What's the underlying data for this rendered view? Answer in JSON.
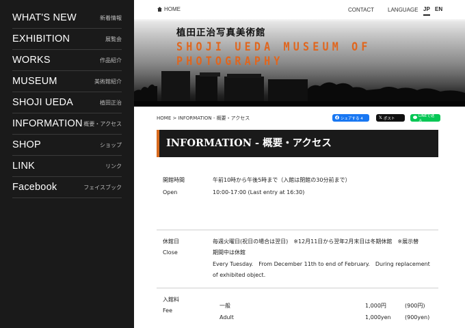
{
  "sidebar": {
    "items": [
      {
        "en": "WHAT'S NEW",
        "ja": "新着情報"
      },
      {
        "en": "EXHIBITION",
        "ja": "展覧会"
      },
      {
        "en": "WORKS",
        "ja": "作品紹介"
      },
      {
        "en": "MUSEUM",
        "ja": "美術館紹介"
      },
      {
        "en": "SHOJI UEDA",
        "ja": "植田正治"
      },
      {
        "en": "INFORMATION",
        "ja": "概要・アクセス"
      },
      {
        "en": "SHOP",
        "ja": "ショップ"
      },
      {
        "en": "LINK",
        "ja": "リンク"
      },
      {
        "en": "Facebook",
        "ja": "フェイスブック"
      }
    ]
  },
  "header": {
    "home_label": "HOME",
    "contact_label": "CONTACT",
    "language_label": "LANGUAGE",
    "lang_jp": "JP",
    "lang_en": "EN",
    "museum_name_ja": "植田正治写真美術館",
    "museum_name_en": "SHOJI UEDA MUSEUM OF PHOTOGRAPHY"
  },
  "breadcrumb": "HOME > INFORMATION - 概要・アクセス",
  "share": {
    "facebook": "シェアする 4",
    "x": "ポスト",
    "line": "LINEで送る"
  },
  "page_title": "INFORMATION - 概要・アクセス",
  "info": {
    "hours": {
      "label_ja": "開館時間",
      "label_en": "Open",
      "value_ja": "午前10時から午後5時まで（入館は閉館の30分前まで）",
      "value_en": "10:00-17:00 (Last entry at 16:30)"
    },
    "closed": {
      "label_ja": "休館日",
      "label_en": "Close",
      "value_ja_1": "毎週火曜日(祝日の場合は翌日)　※12月11日から翌年2月末日は冬期休館　※展示替",
      "value_ja_2": "期間中は休館",
      "value_en_1": "Every Tuesday.　From December 11th to end of February.　During replacement",
      "value_en_2": "of exhibited object."
    },
    "fee": {
      "label_ja": "入館料",
      "label_en": "Fee",
      "rows": [
        {
          "type": "一般",
          "price": "1,000円",
          "group": "(900円)"
        },
        {
          "type": "Adult",
          "price": "1,000yen",
          "group": "(900yen)"
        }
      ]
    }
  }
}
